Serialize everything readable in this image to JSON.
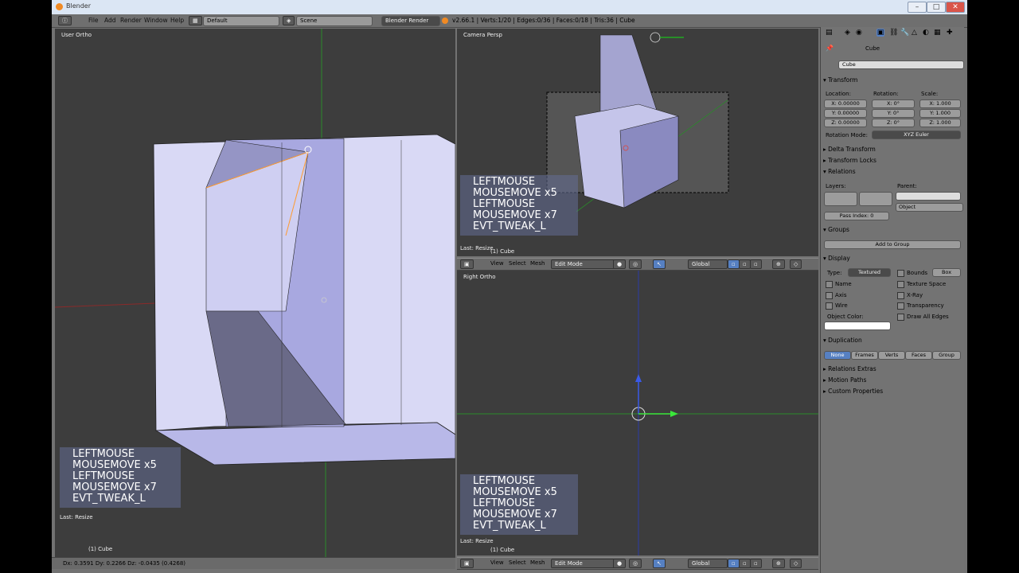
{
  "window": {
    "title": "Blender"
  },
  "menubar": {
    "items": [
      "File",
      "Add",
      "Render",
      "Window",
      "Help"
    ],
    "layout": "Default",
    "scene": "Scene",
    "engine": "Blender Render",
    "stats": "v2.66.1 | Verts:1/20 | Edges:0/36 | Faces:0/18 | Tris:36 | Cube"
  },
  "viewports": {
    "left": {
      "label": "User Ortho",
      "last": "Last: Resize",
      "object": "(1) Cube"
    },
    "top_right": {
      "label": "Camera Persp",
      "last": "Last: Resize",
      "object": "(1) Cube"
    },
    "bottom_right": {
      "label": "Right Ortho",
      "last": "Last: Resize",
      "object": "(1) Cube"
    }
  },
  "keys": [
    "LEFTMOUSE",
    "MOUSEMOVE x5",
    "LEFTMOUSE",
    "MOUSEMOVE x7",
    "EVT_TWEAK_L"
  ],
  "view_header": {
    "view": "View",
    "select": "Select",
    "mesh": "Mesh",
    "mode": "Edit Mode",
    "orientation": "Global"
  },
  "status": {
    "text": "Dx: 0.3591  Dy: 0.2266  Dz: -0.0435 (0.4268)"
  },
  "properties": {
    "object_breadcrumb": "Cube",
    "object_name": "Cube",
    "transform": {
      "title": "Transform",
      "location_label": "Location:",
      "rotation_label": "Rotation:",
      "scale_label": "Scale:",
      "loc": [
        "X: 0.00000",
        "Y: 0.00000",
        "Z: 0.00000"
      ],
      "rot": [
        "X: 0°",
        "Y: 0°",
        "Z: 0°"
      ],
      "scale": [
        "X: 1.000",
        "Y: 1.000",
        "Z: 1.000"
      ],
      "rotation_mode_label": "Rotation Mode:",
      "rotation_mode": "XYZ Euler"
    },
    "delta_transform": "Delta Transform",
    "transform_locks": "Transform Locks",
    "relations": {
      "title": "Relations",
      "layers_label": "Layers:",
      "parent_label": "Parent:",
      "parent_type": "Object",
      "pass_index": "Pass Index: 0"
    },
    "groups": {
      "title": "Groups",
      "add_button": "Add to Group"
    },
    "display": {
      "title": "Display",
      "type_label": "Type:",
      "type": "Textured",
      "bounds_label": "Bounds",
      "bounds_type": "Box",
      "name": "Name",
      "texture_space": "Texture Space",
      "axis": "Axis",
      "xray": "X-Ray",
      "wire": "Wire",
      "transparency": "Transparency",
      "object_color": "Object Color:",
      "draw_all_edges": "Draw All Edges"
    },
    "duplication": {
      "title": "Duplication",
      "options": [
        "None",
        "Frames",
        "Verts",
        "Faces",
        "Group"
      ]
    },
    "relations_extras": "Relations Extras",
    "motion_paths": "Motion Paths",
    "custom_properties": "Custom Properties"
  },
  "colors": {
    "accent": "#5680c2",
    "face": "#c3c3f0",
    "selected_edge": "#ff9a2e"
  }
}
